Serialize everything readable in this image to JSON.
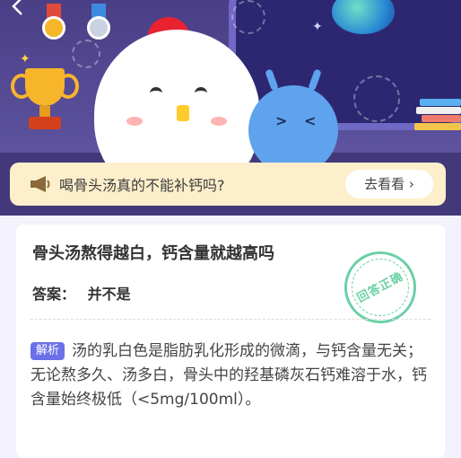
{
  "banner": {
    "question": "喝骨头汤真的不能补钙吗?",
    "button_label": "去看看",
    "button_chevron": "›"
  },
  "card": {
    "title": "骨头汤熬得越白，钙含量就越高吗",
    "answer_label": "答案：",
    "answer_value": "并不是",
    "stamp_text": "回答正确",
    "analysis_tag": "解析",
    "analysis_text": "汤的乳白色是脂肪乳化形成的微滴，与钙含量无关；无论熬多久、汤多白，骨头中的羟基磷灰石钙难溶于水，钙含量始终极低（<5mg/100ml）。"
  },
  "colors": {
    "hero_bg": "#4a3f86",
    "banner_bg": "#fdefcb",
    "tag_bg": "#6c70e8",
    "stamp": "#6bcfa5"
  },
  "icons": {
    "back": "chevron-left-icon",
    "speaker": "megaphone-icon"
  }
}
